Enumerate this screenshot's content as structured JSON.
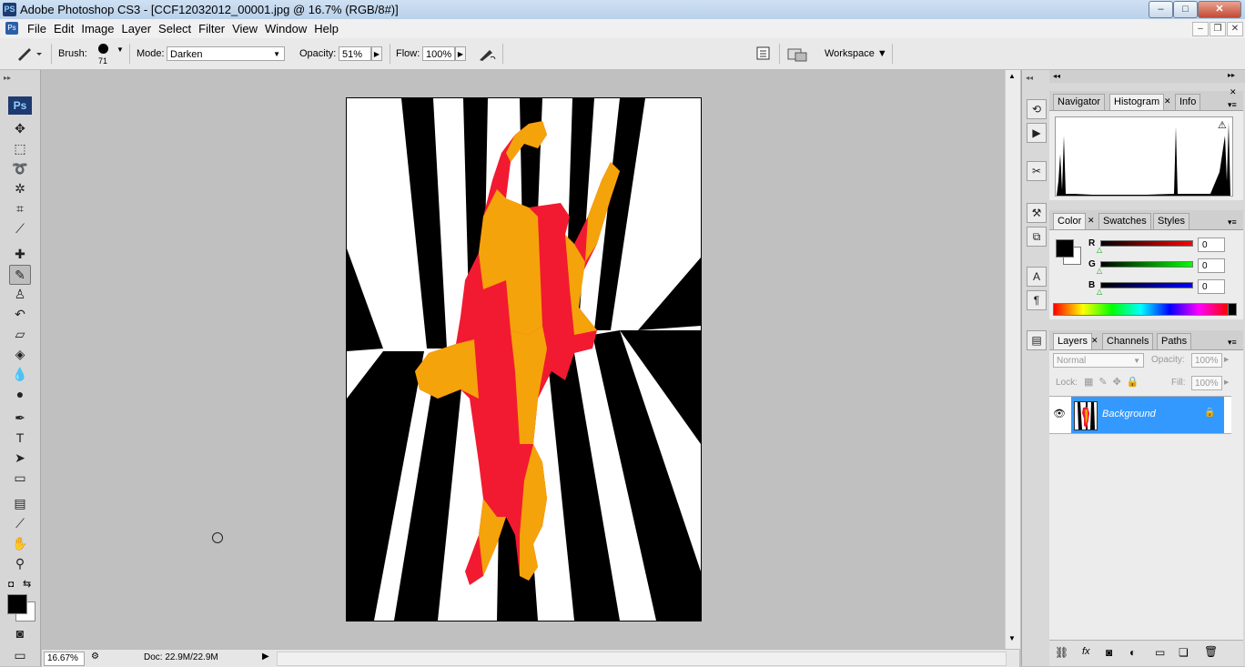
{
  "window": {
    "app_icon": "PS",
    "title": "Adobe Photoshop CS3 - [CCF12032012_00001.jpg @ 16.7% (RGB/8#)]",
    "minimize_glyph": "–",
    "maximize_glyph": "□",
    "close_glyph": "✕"
  },
  "menu": {
    "items": [
      "File",
      "Edit",
      "Image",
      "Layer",
      "Select",
      "Filter",
      "View",
      "Window",
      "Help"
    ],
    "doc_minimize": "–",
    "doc_restore": "❐",
    "doc_close": "✕"
  },
  "options": {
    "brush_label": "Brush:",
    "brush_size": "71",
    "mode_label": "Mode:",
    "mode_value": "Darken",
    "opacity_label": "Opacity:",
    "opacity_value": "51%",
    "flow_label": "Flow:",
    "flow_value": "100%",
    "workspace_label": "Workspace ▼"
  },
  "toolbox": {
    "ps_label": "Ps"
  },
  "status": {
    "zoom": "16.67%",
    "doc": "Doc: 22.9M/22.9M"
  },
  "panels": {
    "nav_tabs": [
      "Navigator",
      "Histogram",
      "Info"
    ],
    "color_tabs": [
      "Color",
      "Swatches",
      "Styles"
    ],
    "color": {
      "r_label": "R",
      "g_label": "G",
      "b_label": "B",
      "r_value": "0",
      "g_value": "0",
      "b_value": "0"
    },
    "layers_tabs": [
      "Layers",
      "Channels",
      "Paths"
    ],
    "layers": {
      "blend_mode": "Normal",
      "opacity_label": "Opacity:",
      "opacity_value": "100%",
      "lock_label": "Lock:",
      "fill_label": "Fill:",
      "fill_value": "100%",
      "layer_name": "Background"
    }
  },
  "colors": {
    "canvas_bg": "#c0c0c0",
    "selected_layer": "#3399ff",
    "dancer_red": "#f21a30",
    "dancer_orange": "#f5a30a"
  }
}
